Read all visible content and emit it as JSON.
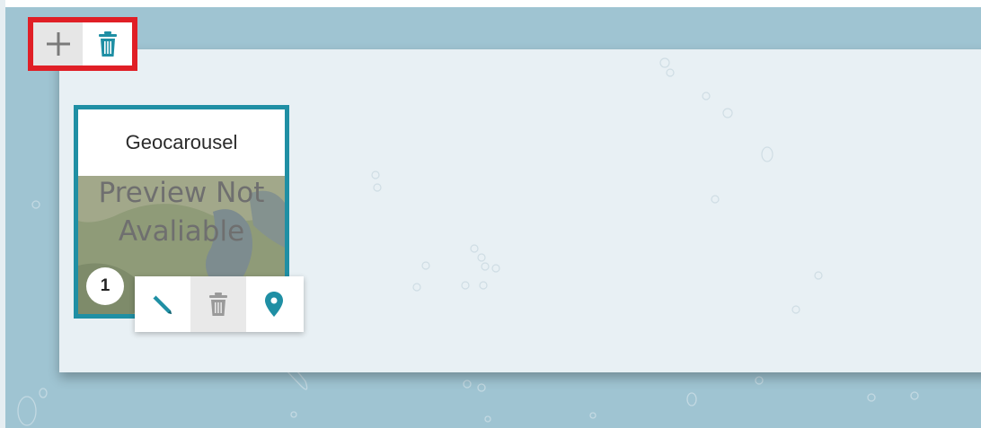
{
  "colors": {
    "accent": "#1f8fa4",
    "highlight": "#e01f26",
    "map_water": "#9fc4d2"
  },
  "toolbar": {
    "add_icon": "plus-icon",
    "delete_icon": "trash-icon"
  },
  "card": {
    "title": "Geocarousel",
    "preview_line1": "Preview Not",
    "preview_line2": "Avaliable",
    "index": "1",
    "actions": [
      {
        "icon": "pencil-icon"
      },
      {
        "icon": "trash-icon"
      },
      {
        "icon": "map-marker-icon"
      }
    ]
  }
}
